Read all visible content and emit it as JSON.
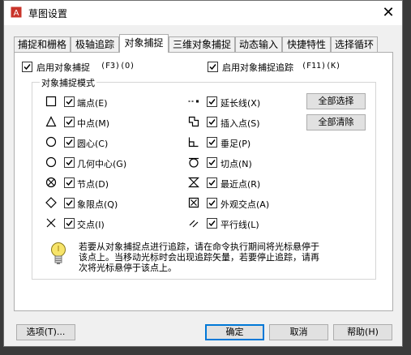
{
  "window": {
    "title": "草图设置"
  },
  "tabs": [
    {
      "label": "捕捉和栅格"
    },
    {
      "label": "极轴追踪"
    },
    {
      "label": "对象捕捉"
    },
    {
      "label": "三维对象捕捉"
    },
    {
      "label": "动态输入"
    },
    {
      "label": "快捷特性"
    },
    {
      "label": "选择循环"
    }
  ],
  "active_tab": "对象捕捉",
  "toggles": {
    "osnap_on": {
      "label": "启用对象捕捉",
      "shortcut": "(F3)(O)",
      "checked": true
    },
    "osnap_tracking_on": {
      "label": "启用对象捕捉追踪",
      "shortcut": "(F11)(K)",
      "checked": true
    }
  },
  "group": {
    "title": "对象捕捉模式",
    "left": [
      {
        "label": "端点(E)",
        "symbol": "square-endpoint-icon",
        "checked": true
      },
      {
        "label": "中点(M)",
        "symbol": "triangle-midpoint-icon",
        "checked": true
      },
      {
        "label": "圆心(C)",
        "symbol": "circle-center-icon",
        "checked": true
      },
      {
        "label": "几何中心(G)",
        "symbol": "circle-geometric-center-icon",
        "checked": true
      },
      {
        "label": "节点(D)",
        "symbol": "circle-x-node-icon",
        "checked": true
      },
      {
        "label": "象限点(Q)",
        "symbol": "diamond-quadrant-icon",
        "checked": true
      },
      {
        "label": "交点(I)",
        "symbol": "x-intersection-icon",
        "checked": true
      }
    ],
    "right": [
      {
        "label": "延长线(X)",
        "symbol": "dashes-extension-icon",
        "checked": true
      },
      {
        "label": "插入点(S)",
        "symbol": "insertion-icon",
        "checked": true
      },
      {
        "label": "垂足(P)",
        "symbol": "perpendicular-icon",
        "checked": true
      },
      {
        "label": "切点(N)",
        "symbol": "tangent-icon",
        "checked": true
      },
      {
        "label": "最近点(R)",
        "symbol": "hourglass-nearest-icon",
        "checked": true
      },
      {
        "label": "外观交点(A)",
        "symbol": "boxed-x-apparent-icon",
        "checked": true
      },
      {
        "label": "平行线(L)",
        "symbol": "parallel-icon",
        "checked": true
      }
    ],
    "select_all_label": "全部选择",
    "clear_all_label": "全部清除"
  },
  "hint": {
    "line1": "若要从对象捕捉点进行追踪，请在命令执行期间将光标悬停于",
    "line2": "该点上。当移动光标时会出现追踪矢量，若要停止追踪，请再",
    "line3": "次将光标悬停于该点上。"
  },
  "footer": {
    "options_label": "选项(T)...",
    "ok_label": "确定",
    "cancel_label": "取消",
    "help_label": "帮助(H)"
  },
  "colors": {
    "accent": "#0078d7",
    "panel": "#ffffff",
    "dialog": "#f0f0f0"
  }
}
